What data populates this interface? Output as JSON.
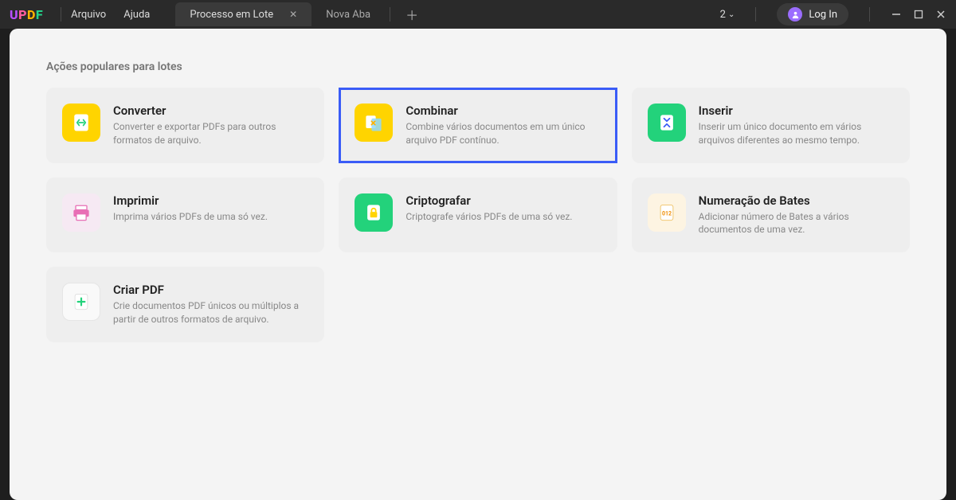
{
  "app": {
    "logo": "UPDF"
  },
  "menu": {
    "file": "Arquivo",
    "help": "Ajuda"
  },
  "tabs": {
    "active": "Processo em Lote",
    "new": "Nova Aba"
  },
  "titlebar": {
    "count": "2",
    "login": "Log In"
  },
  "section": {
    "title": "Ações populares para lotes"
  },
  "cards": {
    "convert": {
      "title": "Converter",
      "desc": "Converter e exportar PDFs para outros formatos de arquivo."
    },
    "combine": {
      "title": "Combinar",
      "desc": "Combine vários documentos em um único arquivo PDF contínuo."
    },
    "insert": {
      "title": "Inserir",
      "desc": "Inserir um único documento em vários arquivos diferentes ao mesmo tempo."
    },
    "print": {
      "title": "Imprimir",
      "desc": "Imprima vários PDFs de uma só vez."
    },
    "encrypt": {
      "title": "Criptografar",
      "desc": "Criptografe vários PDFs de uma só vez."
    },
    "bates": {
      "title": "Numeração de Bates",
      "desc": "Adicionar número de Bates a vários documentos de uma vez."
    },
    "create": {
      "title": "Criar PDF",
      "desc": "Crie documentos PDF únicos ou múltiplos a partir de outros formatos de arquivo."
    }
  }
}
